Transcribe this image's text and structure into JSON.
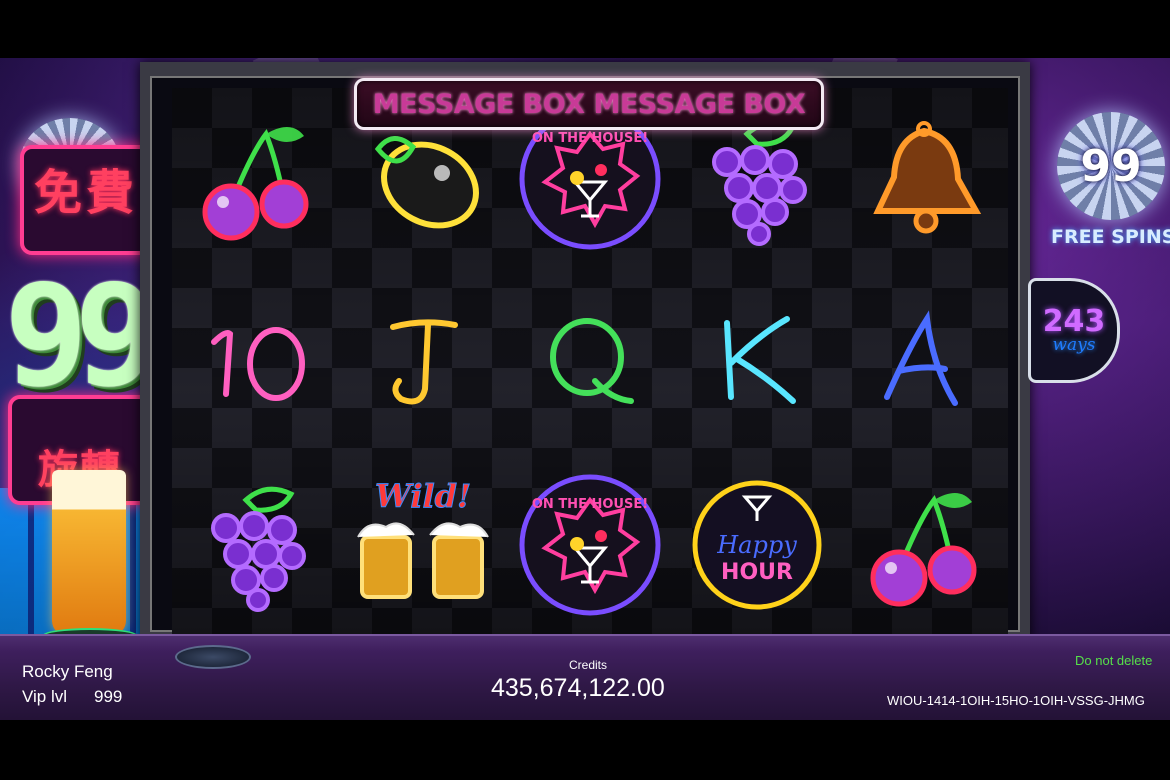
{
  "message_box": {
    "text": "MESSAGE BOX MESSAGE BOX"
  },
  "left_sign": {
    "top_chars": "免費",
    "big_number": "99",
    "bottom_chars": "旋轉"
  },
  "free_spins": {
    "count": "99",
    "label": "FREE SPINS"
  },
  "ways": {
    "count": "243",
    "label": "ways"
  },
  "reels": {
    "rows": [
      [
        "cherries",
        "lemon",
        "on-the-house",
        "grapes",
        "bell"
      ],
      [
        "10",
        "J",
        "Q",
        "K",
        "A"
      ],
      [
        "grapes",
        "wild",
        "on-the-house",
        "happy-hour",
        "cherries"
      ]
    ],
    "on_the_house_text": "ON THE HOUSE!",
    "wild_text": "Wild!",
    "happy_text": "Happy",
    "hour_text": "HOUR"
  },
  "player": {
    "name": "Rocky Feng",
    "vip_label": "Vip lvl",
    "vip_value": "999"
  },
  "credits": {
    "label": "Credits",
    "value": "435,674,122.00"
  },
  "notice": "Do not delete",
  "session_id": "WIOU-1414-1OIH-15HO-1OIH-VSSG-JHMG",
  "colors": {
    "message_text": "#c83a97",
    "cherry": "#a23fd6",
    "lemon": "#ffe13a",
    "grape": "#9b4df0",
    "bell": "#ff9a2a",
    "ten": "#ff5fc0",
    "jack": "#ffc830",
    "queen": "#44e05a",
    "king": "#59e6ff",
    "ace": "#4a6cff",
    "notice": "#56e04a"
  }
}
